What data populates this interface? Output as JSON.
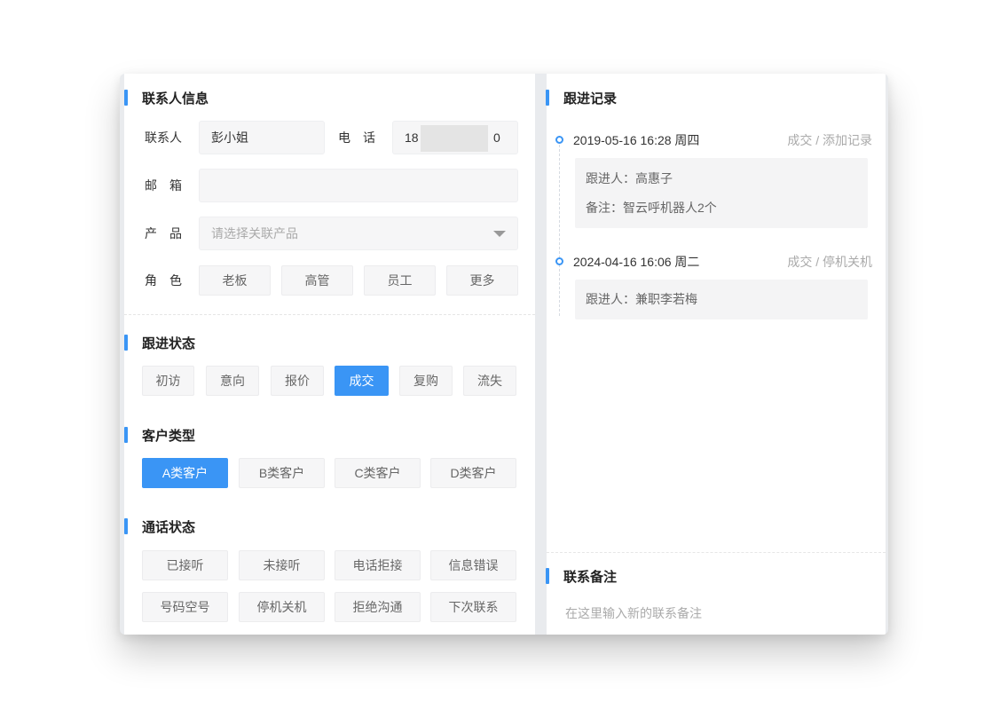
{
  "contact_section": {
    "title": "联系人信息",
    "name_label": "联系人",
    "name_value": "彭小姐",
    "phone_label": "电　话",
    "phone_value_start": "18",
    "phone_value_end": "0",
    "email_label": "邮　箱",
    "email_value": "",
    "product_label": "产　品",
    "product_placeholder": "请选择关联产品",
    "role_label": "角　色",
    "roles": [
      "老板",
      "高管",
      "员工",
      "更多"
    ]
  },
  "follow_status": {
    "title": "跟进状态",
    "options": [
      "初访",
      "意向",
      "报价",
      "成交",
      "复购",
      "流失"
    ],
    "selected": "成交"
  },
  "customer_type": {
    "title": "客户类型",
    "options": [
      "A类客户",
      "B类客户",
      "C类客户",
      "D类客户"
    ],
    "selected": "A类客户"
  },
  "call_status": {
    "title": "通话状态",
    "options": [
      "已接听",
      "未接听",
      "电话拒接",
      "信息错误",
      "号码空号",
      "停机关机",
      "拒绝沟通",
      "下次联系"
    ]
  },
  "follow_records": {
    "title": "跟进记录",
    "records": [
      {
        "datetime": "2019-05-16 16:28 周四",
        "tag": "成交 / 添加记录",
        "lines": [
          "跟进人：高惠子",
          "备注：智云呼机器人2个"
        ]
      },
      {
        "datetime": "2024-04-16 16:06 周二",
        "tag": "成交 / 停机关机",
        "lines": [
          "跟进人：兼职李若梅"
        ]
      }
    ]
  },
  "contact_note": {
    "title": "联系备注",
    "placeholder": "在这里输入新的联系备注"
  },
  "colors": {
    "accent": "#3a95f5",
    "chip_bg": "#f6f6f7",
    "panel_gap": "#e9ebee"
  }
}
